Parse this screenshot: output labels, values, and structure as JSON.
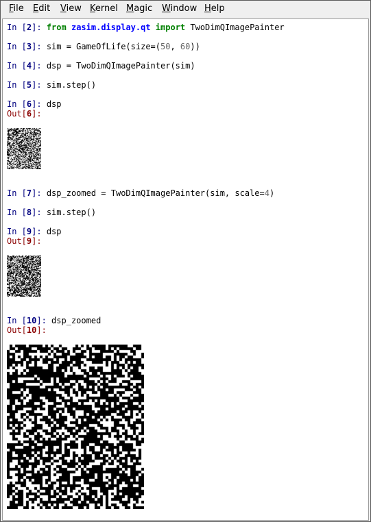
{
  "menu": [
    {
      "label": "File",
      "mnemonic": "F",
      "rest": "ile"
    },
    {
      "label": "Edit",
      "mnemonic": "E",
      "rest": "dit"
    },
    {
      "label": "View",
      "mnemonic": "V",
      "rest": "iew"
    },
    {
      "label": "Kernel",
      "mnemonic": "K",
      "rest": "ernel"
    },
    {
      "label": "Magic",
      "mnemonic": "M",
      "rest": "agic"
    },
    {
      "label": "Window",
      "mnemonic": "W",
      "rest": "indow"
    },
    {
      "label": "Help",
      "mnemonic": "H",
      "rest": "elp"
    }
  ],
  "cells": {
    "in2": {
      "prompt": "In [",
      "num": "2",
      "close": "]: ",
      "kw1": "from",
      "mod": "zasim.display.qt",
      "kw2": "import",
      "rest": " TwoDimQImagePainter"
    },
    "in3": {
      "prompt": "In [",
      "num": "3",
      "close": "]: ",
      "code1": "sim = GameOfLife(size=(",
      "n1": "50",
      "code2": ", ",
      "n2": "60",
      "code3": "))"
    },
    "in4": {
      "prompt": "In [",
      "num": "4",
      "close": "]: ",
      "code": "dsp = TwoDimQImagePainter(sim)"
    },
    "in5": {
      "prompt": "In [",
      "num": "5",
      "close": "]: ",
      "code": "sim.step()"
    },
    "in6": {
      "prompt": "In [",
      "num": "6",
      "close": "]: ",
      "code": "dsp"
    },
    "out6": {
      "prompt": "Out[",
      "num": "6",
      "close": "]:"
    },
    "in7": {
      "prompt": "In [",
      "num": "7",
      "close": "]: ",
      "code1": "dsp_zoomed = TwoDimQImagePainter(sim, scale=",
      "n1": "4",
      "code2": ")"
    },
    "in8": {
      "prompt": "In [",
      "num": "8",
      "close": "]: ",
      "code": "sim.step()"
    },
    "in9": {
      "prompt": "In [",
      "num": "9",
      "close": "]: ",
      "code": "dsp"
    },
    "out9": {
      "prompt": "Out[",
      "num": "9",
      "close": "]:"
    },
    "in10": {
      "prompt": "In [",
      "num": "10",
      "close": "]: ",
      "code": "dsp_zoomed"
    },
    "out10": {
      "prompt": "Out[",
      "num": "10",
      "close": "]:"
    }
  },
  "grid": {
    "cols": 50,
    "rows": 60,
    "colors": {
      "alive": "#000000",
      "dead": "#ffffff"
    }
  }
}
